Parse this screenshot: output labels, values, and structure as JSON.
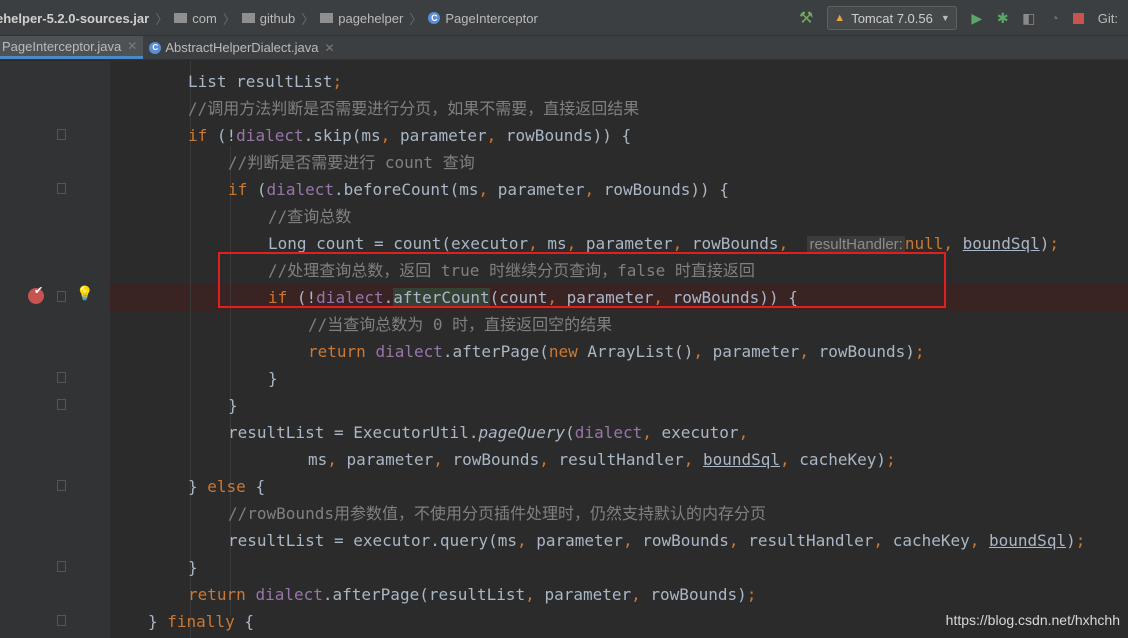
{
  "breadcrumbs": [
    {
      "label": "ehelper-5.2.0-sources.jar",
      "kind": "jar"
    },
    {
      "label": "com",
      "kind": "folder"
    },
    {
      "label": "github",
      "kind": "folder"
    },
    {
      "label": "pagehelper",
      "kind": "folder"
    },
    {
      "label": "PageInterceptor",
      "kind": "class"
    }
  ],
  "toolbar": {
    "run_config": "Tomcat 7.0.56",
    "vcs_label": "Git:"
  },
  "tabs": [
    {
      "label": "PageInterceptor.java",
      "active": true
    },
    {
      "label": "AbstractHelperDialect.java",
      "active": false
    }
  ],
  "code_lines": [
    "List resultList;",
    "//调用方法判断是否需要进行分页，如果不需要，直接返回结果",
    "if (!dialect.skip(ms, parameter, rowBounds)) {",
    "//判断是否需要进行 count 查询",
    "if (dialect.beforeCount(ms, parameter, rowBounds)) {",
    "//查询总数",
    "Long count = count(executor, ms, parameter, rowBounds, ",
    "//处理查询总数，返回 true 时继续分页查询，false 时直接返回",
    "if (!dialect.afterCount(count, parameter, rowBounds)) {",
    "//当查询总数为 0 时，直接返回空的结果",
    "return dialect.afterPage(new ArrayList(), parameter, rowBounds);",
    "}",
    "}",
    "resultList = ExecutorUtil.pageQuery(dialect, executor,",
    "ms, parameter, rowBounds, resultHandler, boundSql, cacheKey);",
    "} else {",
    "//rowBounds用参数值，不使用分页插件处理时，仍然支持默认的内存分页",
    "resultList = executor.query(ms, parameter, rowBounds, resultHandler, cacheKey, boundSql);",
    "}",
    "return dialect.afterPage(resultList, parameter, rowBounds);",
    "} finally {"
  ],
  "inlay_hint": "resultHandler:",
  "watermark": "https://blog.csdn.net/hxhchh",
  "colors": {
    "annotation_box": "#e02020",
    "keyword": "#cc7832",
    "comment": "#808080",
    "field": "#9876aa",
    "text": "#a9b7c6"
  }
}
